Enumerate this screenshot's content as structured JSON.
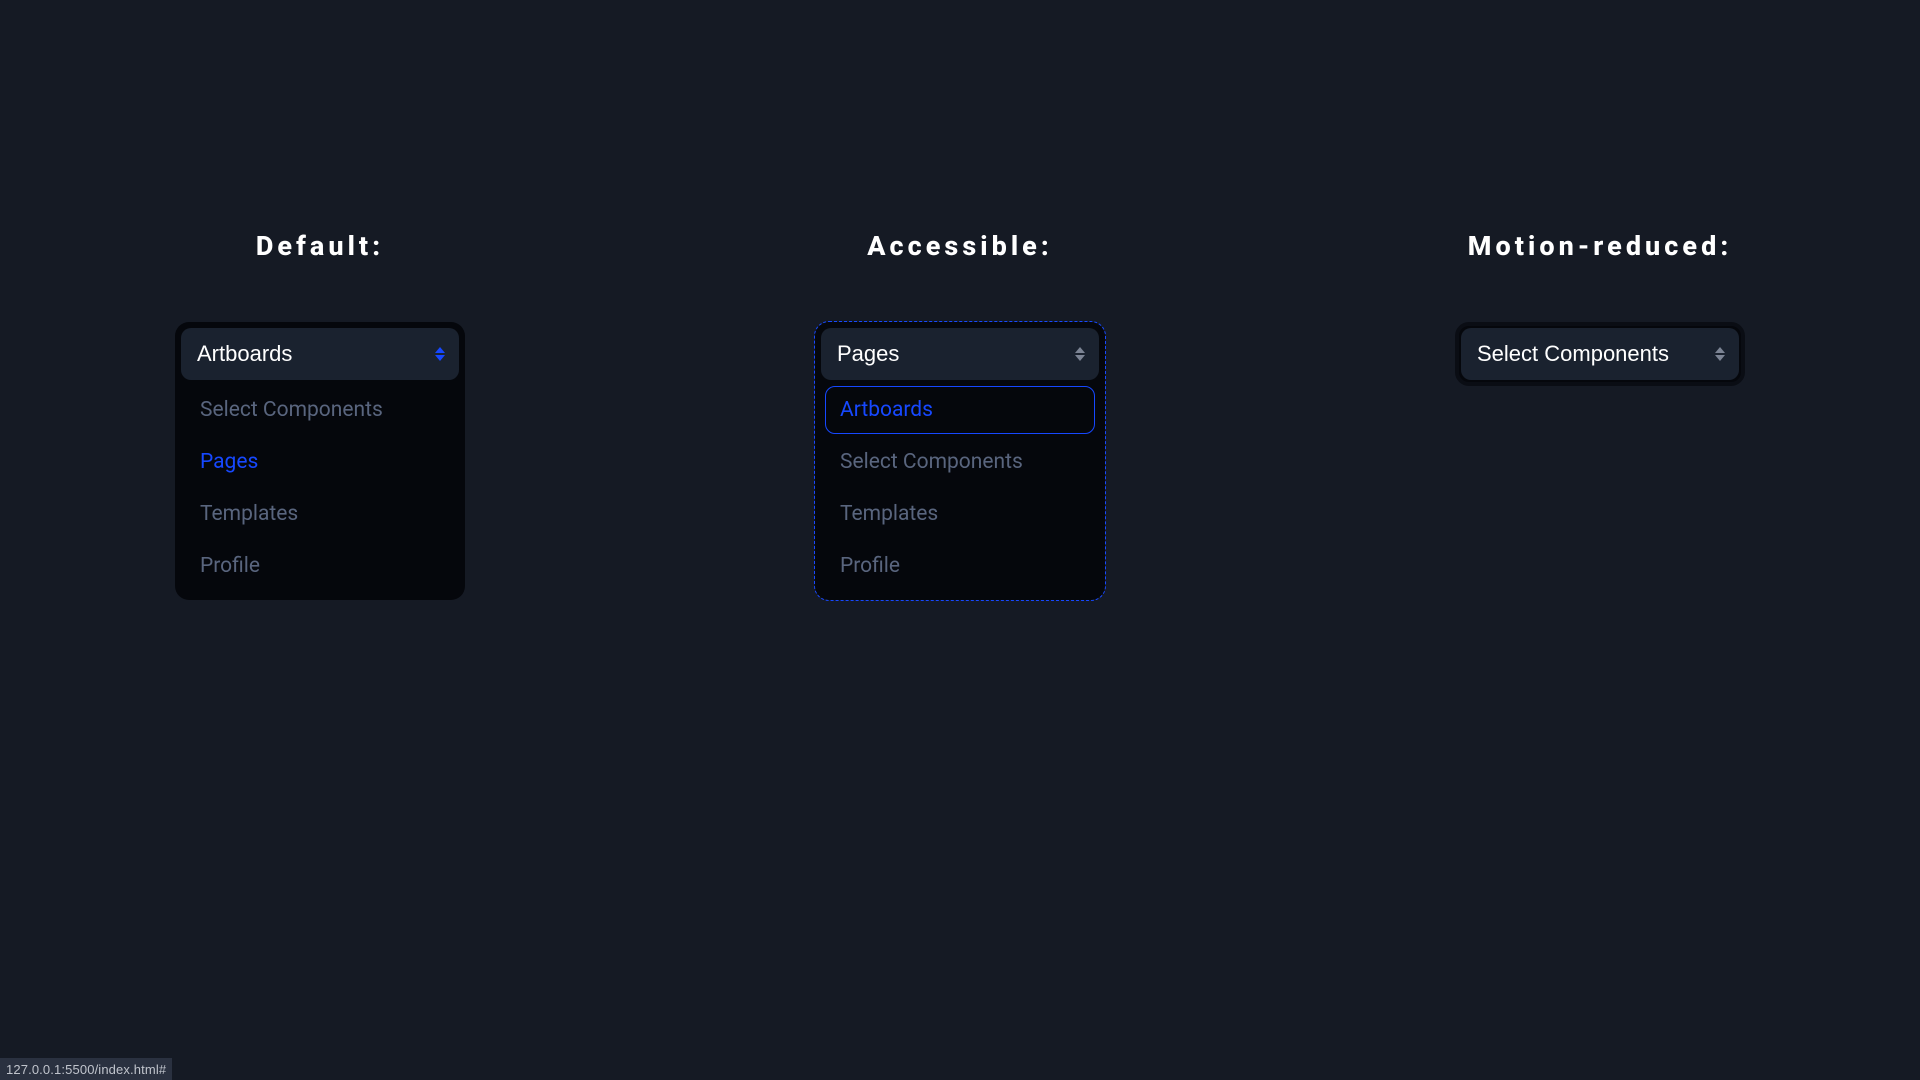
{
  "columns": {
    "default": {
      "heading": "Default:",
      "selected": "Artboards",
      "arrow_color": "blue",
      "options": [
        {
          "label": "Select Components",
          "highlight": false,
          "boxed": false
        },
        {
          "label": "Pages",
          "highlight": true,
          "boxed": false
        },
        {
          "label": "Templates",
          "highlight": false,
          "boxed": false
        },
        {
          "label": "Profile",
          "highlight": false,
          "boxed": false
        }
      ]
    },
    "accessible": {
      "heading": "Accessible:",
      "selected": "Pages",
      "arrow_color": "grey",
      "options": [
        {
          "label": "Artboards",
          "highlight": true,
          "boxed": true
        },
        {
          "label": "Select Components",
          "highlight": false,
          "boxed": false
        },
        {
          "label": "Templates",
          "highlight": false,
          "boxed": false
        },
        {
          "label": "Profile",
          "highlight": false,
          "boxed": false
        }
      ]
    },
    "reduced": {
      "heading": "Motion-reduced:",
      "selected": "Select Components",
      "arrow_color": "grey"
    }
  },
  "status_bar": "127.0.0.1:5500/index.html#"
}
